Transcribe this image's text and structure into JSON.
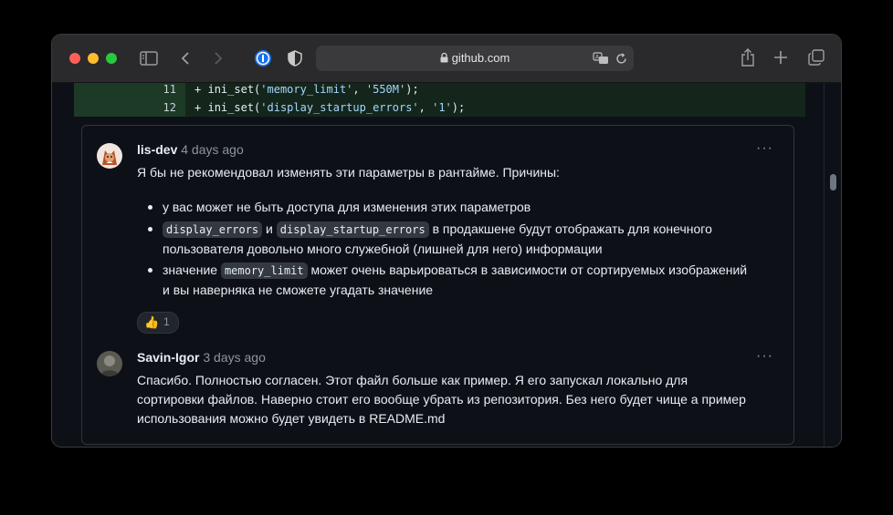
{
  "browser": {
    "url": "github.com",
    "icons": [
      "sidebar-icon",
      "back-icon",
      "forward-icon",
      "password-manager-icon",
      "shield-icon",
      "lock-icon",
      "translate-icon",
      "reload-icon",
      "share-icon",
      "new-tab-icon",
      "tabs-overview-icon"
    ]
  },
  "diff": {
    "lines": [
      {
        "number": "11",
        "prefix": "+",
        "func": "ini_set(",
        "arg1": "'memory_limit'",
        "sep": ", ",
        "arg2": "'550M'",
        "end": ");"
      },
      {
        "number": "12",
        "prefix": "+",
        "func": "ini_set(",
        "arg1": "'display_startup_errors'",
        "sep": ", ",
        "arg2": "'1'",
        "end": ");"
      }
    ]
  },
  "comments": [
    {
      "author": "lis-dev",
      "time": "4 days ago",
      "more": "···",
      "intro": "Я бы не рекомендовал изменять эти параметры в рантайме. Причины:",
      "bullets": {
        "b1": "у вас может не быть доступа для изменения этих параметров",
        "b2_code1": "display_errors",
        "b2_and": "и",
        "b2_code2": "display_startup_errors",
        "b2_text1": "в продакшене будут отображать для конечного",
        "b2_text2": "пользователя довольно много служебной (лишней для него) информации",
        "b3_text0": "значение",
        "b3_code": "memory_limit",
        "b3_text1": "может очень варьироваться в зависимости от сортируемых изображений",
        "b3_text2": "и вы наверняка не сможете угадать значение"
      },
      "reaction": {
        "emoji": "👍",
        "count": "1"
      }
    },
    {
      "author": "Savin-Igor",
      "time": "3 days ago",
      "more": "···",
      "line1": "Спасибо. Полностью согласен. Этот файл больше как пример. Я его запускал локально для",
      "line2": "сортировки файлов. Наверно стоит его вообще убрать из репозитория. Без него будет чище а пример",
      "line3": "использования можно будет увидеть в README.md"
    }
  ],
  "colors": {
    "close": "#ff5f57",
    "minimize": "#febc2e",
    "zoom": "#28c840",
    "diff_add_bg": "#14261b",
    "diff_add_gutter": "#1d3a27",
    "string": "#a5d6ff"
  }
}
